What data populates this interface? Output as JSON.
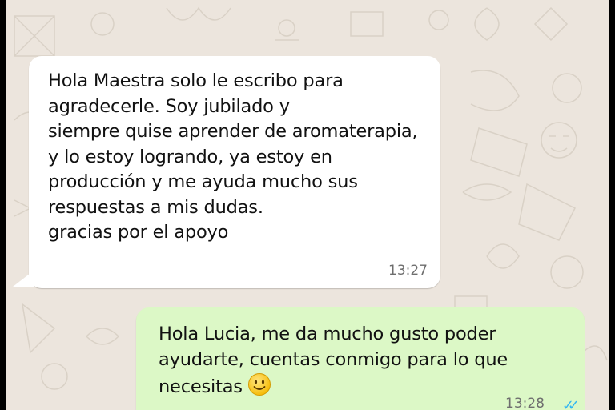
{
  "conversation": {
    "incoming": {
      "lines": [
        "Hola Maestra solo le escribo para",
        "agradecerle. Soy jubilado y",
        "siempre quise aprender de aromaterapia,",
        "y lo estoy logrando, ya estoy en",
        "producción y me ayuda mucho sus",
        "respuestas a mis dudas.",
        "gracias por el apoyo"
      ],
      "time": "13:27"
    },
    "outgoing": {
      "lines": [
        "Hola Lucia, me da mucho gusto poder",
        "ayudarte, cuentas conmigo para lo que",
        "necesitas"
      ],
      "emoji": "smiling-face-icon",
      "time": "13:28",
      "status_icon": "double-check-icon"
    }
  },
  "colors": {
    "chat_background": "#ece5dd",
    "incoming_bubble": "#ffffff",
    "outgoing_bubble": "#dcf8c6",
    "read_ticks": "#34b7f1"
  }
}
